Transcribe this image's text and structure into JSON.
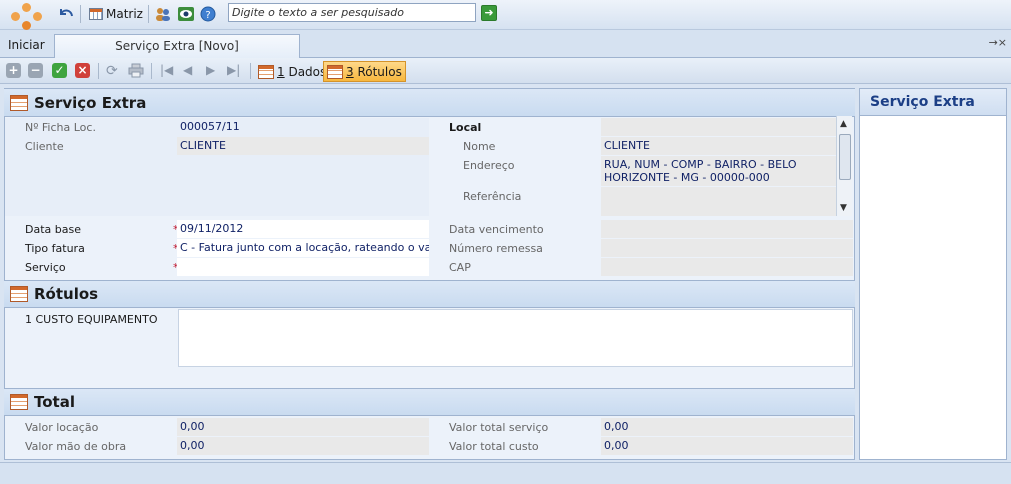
{
  "toolbar": {
    "matriz_label": "Matriz",
    "search_placeholder": "Digite o texto a ser pesquisado"
  },
  "tabs": {
    "home_label": "Iniciar",
    "active_tab": "Serviço Extra [Novo]",
    "pin_glyph": "→×"
  },
  "actions": {
    "dados_num": "1",
    "dados_label": " Dados",
    "rotulos_num": "3",
    "rotulos_label": " Rótulos"
  },
  "section_servico": {
    "title": "Serviço Extra",
    "ficha_label": "Nº Ficha Loc.",
    "ficha_value": "000057/11",
    "cliente_label": "Cliente",
    "cliente_value": "CLIENTE",
    "local_label": "Local",
    "nome_label": "Nome",
    "nome_value": "CLIENTE",
    "endereco_label": "Endereço",
    "endereco_value_1": "RUA, NUM - COMP - BAIRRO - BELO",
    "endereco_value_2": "HORIZONTE - MG - 00000-000",
    "referencia_label": "Referência",
    "data_base_label": "Data base",
    "data_base_value": "09/11/2012",
    "tipo_fatura_label": "Tipo fatura",
    "tipo_fatura_value": "C - Fatura junto com a locação, rateando o valor do",
    "servico_label": "Serviço",
    "servico_value": "",
    "data_venc_label": "Data vencimento",
    "numero_remessa_label": "Número remessa",
    "cap_label": "CAP",
    "required_mark": "*"
  },
  "section_rotulos": {
    "title": "Rótulos",
    "item_label": "1 CUSTO EQUIPAMENTO"
  },
  "section_total": {
    "title": "Total",
    "valor_locacao_label": "Valor locação",
    "valor_locacao_value": "0,00",
    "valor_mao_label": "Valor mão de obra",
    "valor_mao_value": "0,00",
    "valor_total_servico_label": "Valor total serviço",
    "valor_total_servico_value": "0,00",
    "valor_total_custo_label": "Valor total custo",
    "valor_total_custo_value": "0,00"
  },
  "right_panel": {
    "title": "Serviço Extra"
  },
  "colors": {
    "accent_orange": "#f7b73e",
    "required_red": "#c0152b",
    "title_blue": "#1c3f86"
  }
}
